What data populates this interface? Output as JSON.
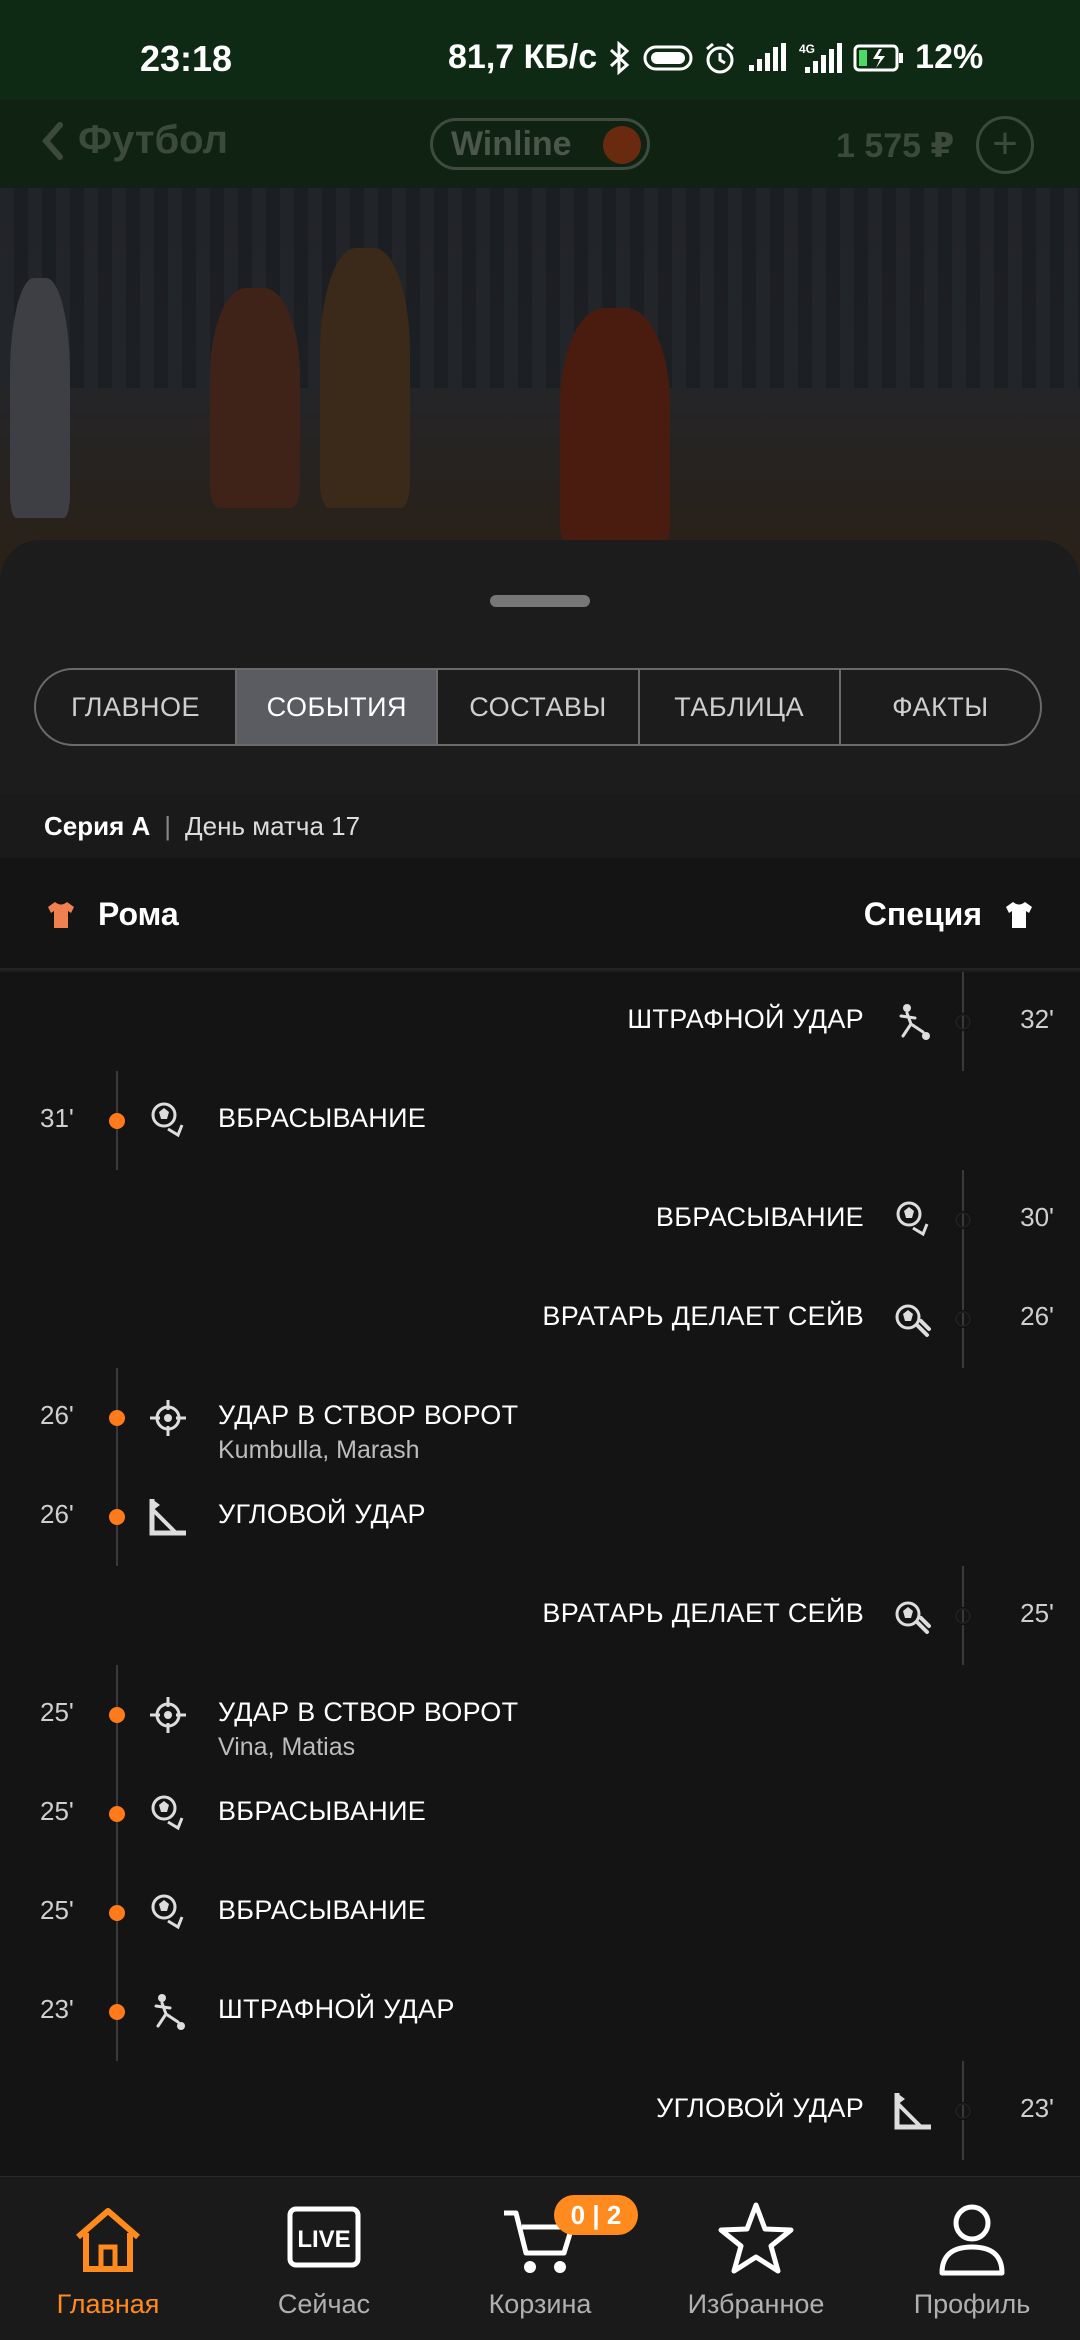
{
  "status_bar": {
    "time": "23:18",
    "speed": "81,7 КБ/с",
    "battery": "12%",
    "network": "4G"
  },
  "header": {
    "back_label": "Футбол",
    "brand": "Winline",
    "balance": "1 575 ₽",
    "plus": "+"
  },
  "tabs": [
    {
      "label": "ГЛАВНОЕ",
      "active": false
    },
    {
      "label": "СОБЫТИЯ",
      "active": true
    },
    {
      "label": "СОСТАВЫ",
      "active": false
    },
    {
      "label": "ТАБЛИЦА",
      "active": false
    },
    {
      "label": "ФАКТЫ",
      "active": false
    }
  ],
  "league": {
    "name": "Серия А",
    "separator": "|",
    "matchday": "День матча 17"
  },
  "teams": {
    "home": "Рома",
    "away": "Специя",
    "home_color": "#f08050",
    "away_color": "#ffffff"
  },
  "events": [
    {
      "side": "away",
      "minute": "32'",
      "title": "ШТРАФНОЙ УДАР",
      "icon": "free-kick-icon"
    },
    {
      "side": "home",
      "minute": "31'",
      "title": "ВБРАСЫВАНИЕ",
      "icon": "throw-in-icon"
    },
    {
      "side": "away",
      "minute": "30'",
      "title": "ВБРАСЫВАНИЕ",
      "icon": "throw-in-icon"
    },
    {
      "side": "away",
      "minute": "26'",
      "title": "ВРАТАРЬ ДЕЛАЕТ СЕЙВ",
      "icon": "goalkeeper-save-icon"
    },
    {
      "side": "home",
      "minute": "26'",
      "title": "УДАР В СТВОР ВОРОТ",
      "sub": "Kumbulla, Marash",
      "icon": "shot-on-target-icon"
    },
    {
      "side": "home",
      "minute": "26'",
      "title": "УГЛОВОЙ УДАР",
      "icon": "corner-icon"
    },
    {
      "side": "away",
      "minute": "25'",
      "title": "ВРАТАРЬ ДЕЛАЕТ СЕЙВ",
      "icon": "goalkeeper-save-icon"
    },
    {
      "side": "home",
      "minute": "25'",
      "title": "УДАР В СТВОР ВОРОТ",
      "sub": "Vina, Matias",
      "icon": "shot-on-target-icon"
    },
    {
      "side": "home",
      "minute": "25'",
      "title": "ВБРАСЫВАНИЕ",
      "icon": "throw-in-icon"
    },
    {
      "side": "home",
      "minute": "25'",
      "title": "ВБРАСЫВАНИЕ",
      "icon": "throw-in-icon"
    },
    {
      "side": "home",
      "minute": "23'",
      "title": "ШТРАФНОЙ УДАР",
      "icon": "free-kick-icon"
    },
    {
      "side": "away",
      "minute": "23'",
      "title": "УГЛОВОЙ УДАР",
      "icon": "corner-icon"
    }
  ],
  "bottom_nav": [
    {
      "label": "Главная",
      "icon": "home-icon",
      "active": true
    },
    {
      "label": "Сейчас",
      "icon": "live-icon",
      "active": false,
      "icon_text": "LIVE"
    },
    {
      "label": "Корзина",
      "icon": "cart-icon",
      "active": false,
      "badge": "0 | 2"
    },
    {
      "label": "Избранное",
      "icon": "star-icon",
      "active": false
    },
    {
      "label": "Профиль",
      "icon": "profile-icon",
      "active": false
    }
  ],
  "colors": {
    "accent": "#ff8a1e",
    "home_dot": "#ff7a1a",
    "sheet_bg": "#1c1c1c",
    "page_bg": "#141414"
  }
}
